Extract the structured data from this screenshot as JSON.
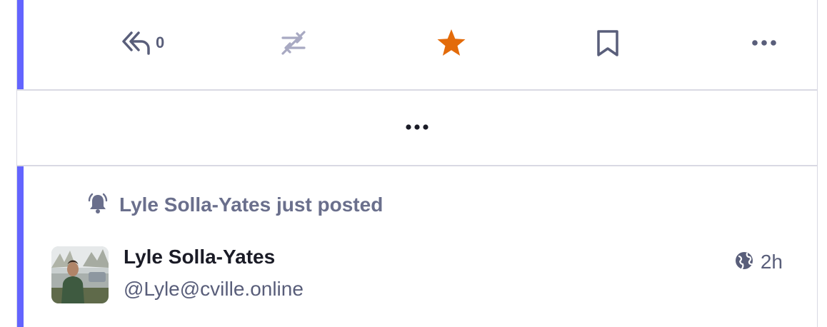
{
  "colors": {
    "accent": "#6364ff",
    "favorite_active": "#e36b0a",
    "icon_default": "#595e7a",
    "icon_disabled": "#a8a9c2",
    "divider": "#d9d9e3"
  },
  "action_bar": {
    "reply": {
      "icon": "reply-all-icon",
      "count": "0"
    },
    "boost": {
      "icon": "boost-disabled-icon"
    },
    "favourite": {
      "icon": "star-icon",
      "active": true
    },
    "bookmark": {
      "icon": "bookmark-icon"
    },
    "more": {
      "icon": "ellipsis-icon"
    }
  },
  "load_more": {
    "icon": "ellipsis-icon"
  },
  "status": {
    "notification": {
      "icon": "bell-ringing-icon",
      "text": "Lyle Solla-Yates just posted"
    },
    "author": {
      "display_name": "Lyle Solla-Yates",
      "handle": "@Lyle@cville.online"
    },
    "visibility_icon": "globe-icon",
    "timestamp": "2h"
  }
}
